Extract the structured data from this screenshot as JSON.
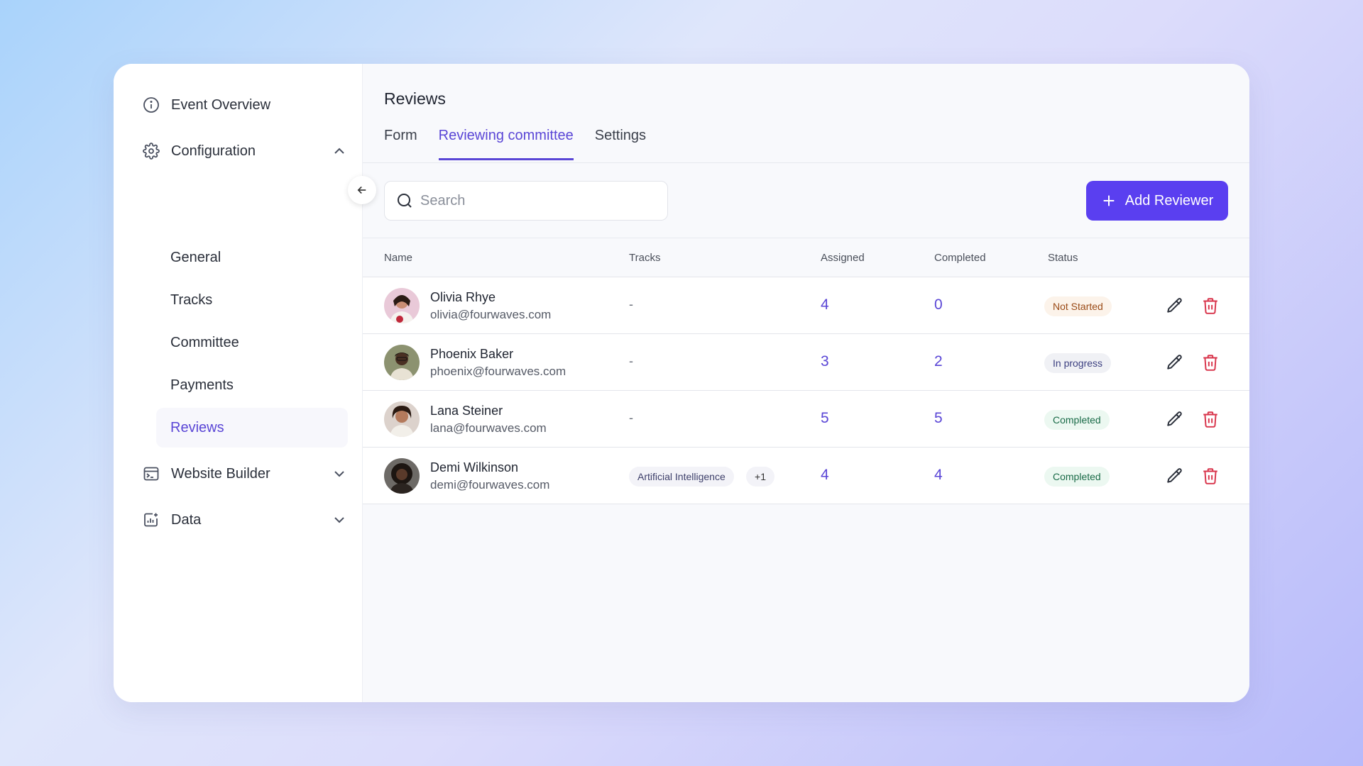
{
  "sidebar": {
    "event_overview": "Event Overview",
    "configuration": "Configuration",
    "sub_items": [
      "General",
      "Tracks",
      "Committee",
      "Payments",
      "Reviews"
    ],
    "website_builder": "Website Builder",
    "data": "Data"
  },
  "header": {
    "title": "Reviews",
    "tabs": [
      "Form",
      "Reviewing committee",
      "Settings"
    ],
    "active_tab": "Reviewing committee"
  },
  "search": {
    "placeholder": "Search"
  },
  "add_button": "Add Reviewer",
  "table": {
    "columns": [
      "Name",
      "Tracks",
      "Assigned",
      "Completed",
      "Status"
    ],
    "rows": [
      {
        "name": "Olivia Rhye",
        "email": "olivia@fourwaves.com",
        "tracks": "-",
        "assigned": "4",
        "completed": "0",
        "status": "Not Started"
      },
      {
        "name": "Phoenix Baker",
        "email": "phoenix@fourwaves.com",
        "tracks": "-",
        "assigned": "3",
        "completed": "2",
        "status": "In progress"
      },
      {
        "name": "Lana Steiner",
        "email": "lana@fourwaves.com",
        "tracks": "-",
        "assigned": "5",
        "completed": "5",
        "status": "Completed"
      },
      {
        "name": "Demi Wilkinson",
        "email": "demi@fourwaves.com",
        "tracks": "Artificial Intelligence",
        "tracks_more": "+1",
        "assigned": "4",
        "completed": "4",
        "status": "Completed"
      }
    ]
  },
  "colors": {
    "accent": "#5a46d6",
    "button": "#5a3ff0",
    "delete": "#d8334a"
  }
}
